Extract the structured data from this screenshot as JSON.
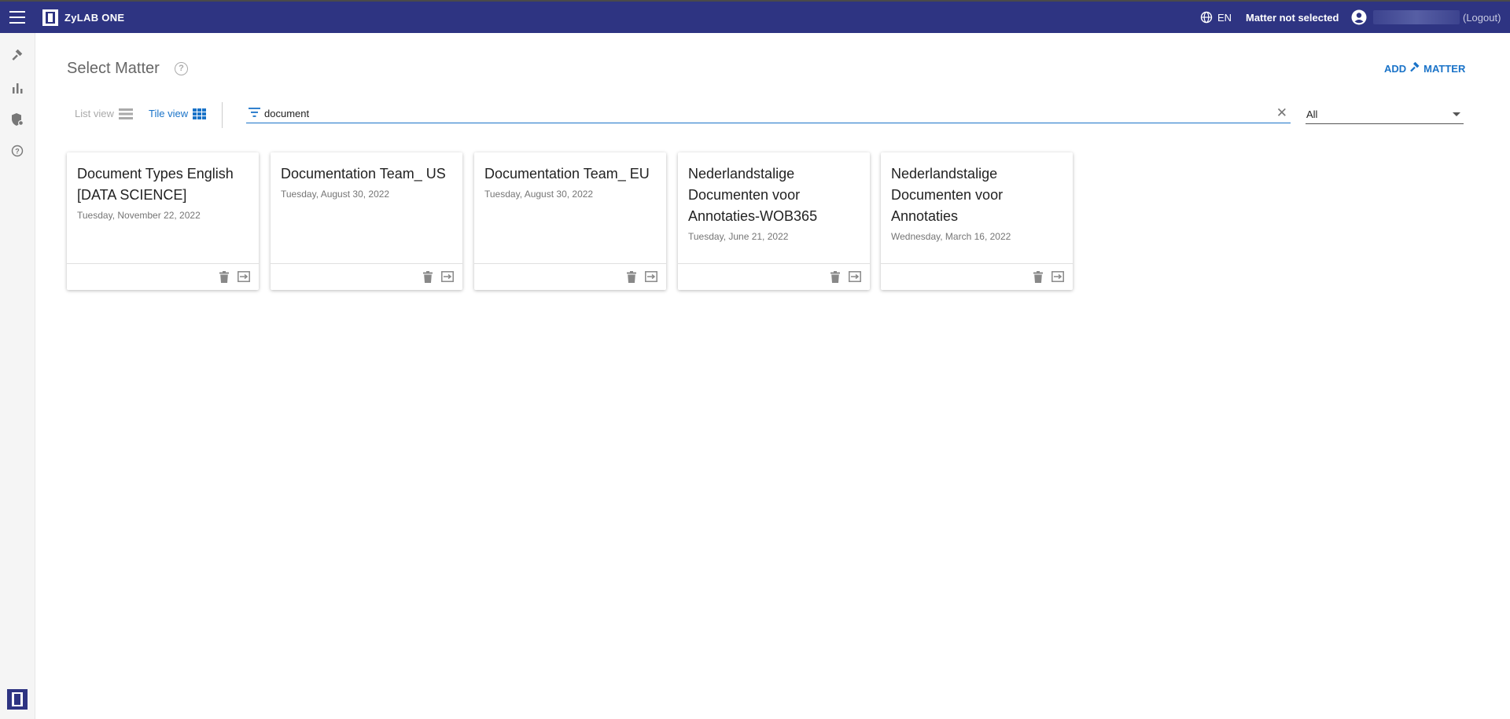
{
  "header": {
    "logo_text": "ZyLAB ONE",
    "language": "EN",
    "matter_status": "Matter not selected",
    "logout_label": "(Logout)"
  },
  "page": {
    "title": "Select Matter",
    "add_button_prefix": "ADD",
    "add_button_suffix": "MATTER"
  },
  "toolbar": {
    "list_view_label": "List view",
    "tile_view_label": "Tile view",
    "active_view": "tile",
    "filter_value": "document",
    "select_value": "All"
  },
  "colors": {
    "header_bg": "#2e3482",
    "accent": "#1a73c8"
  },
  "matters": [
    {
      "title": "Document Types English [DATA SCIENCE]",
      "date": "Tuesday, November 22, 2022"
    },
    {
      "title": "Documentation Team_ US",
      "date": "Tuesday, August 30, 2022"
    },
    {
      "title": "Documentation Team_ EU",
      "date": "Tuesday, August 30, 2022"
    },
    {
      "title": "Nederlandstalige Documenten voor Annotaties-WOB365",
      "date": "Tuesday, June 21, 2022"
    },
    {
      "title": "Nederlandstalige Documenten voor Annotaties",
      "date": "Wednesday, March 16, 2022"
    }
  ]
}
